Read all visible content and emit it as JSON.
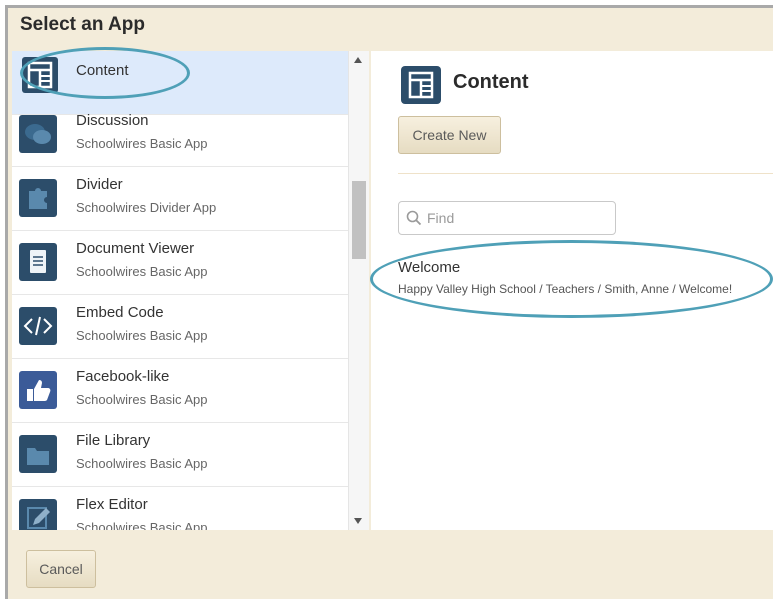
{
  "dialog": {
    "title": "Select an App"
  },
  "apps": [
    {
      "name": "Content",
      "subtitle": "",
      "icon": "content-icon",
      "selected": true
    },
    {
      "name": "Discussion",
      "subtitle": "Schoolwires Basic App",
      "icon": "chat-bubbles-icon"
    },
    {
      "name": "Divider",
      "subtitle": "Schoolwires Divider App",
      "icon": "puzzle-icon"
    },
    {
      "name": "Document Viewer",
      "subtitle": "Schoolwires Basic App",
      "icon": "document-icon"
    },
    {
      "name": "Embed Code",
      "subtitle": "Schoolwires Basic App",
      "icon": "code-icon"
    },
    {
      "name": "Facebook-like",
      "subtitle": "Schoolwires Basic App",
      "icon": "thumbs-up-icon"
    },
    {
      "name": "File Library",
      "subtitle": "Schoolwires Basic App",
      "icon": "folder-icon"
    },
    {
      "name": "Flex Editor",
      "subtitle": "Schoolwires Basic App",
      "icon": "pencil-icon"
    }
  ],
  "detail": {
    "title": "Content",
    "create_label": "Create New",
    "search_placeholder": "Find",
    "result": {
      "title": "Welcome",
      "path": "Happy Valley High School / Teachers / Smith, Anne / Welcome!"
    }
  },
  "footer": {
    "cancel_label": "Cancel"
  },
  "colors": {
    "accent": "#2c4d6a",
    "selected_row": "#ddeafb",
    "annotation": "#4fa0b7",
    "panel_bg": "#f3ecda"
  }
}
